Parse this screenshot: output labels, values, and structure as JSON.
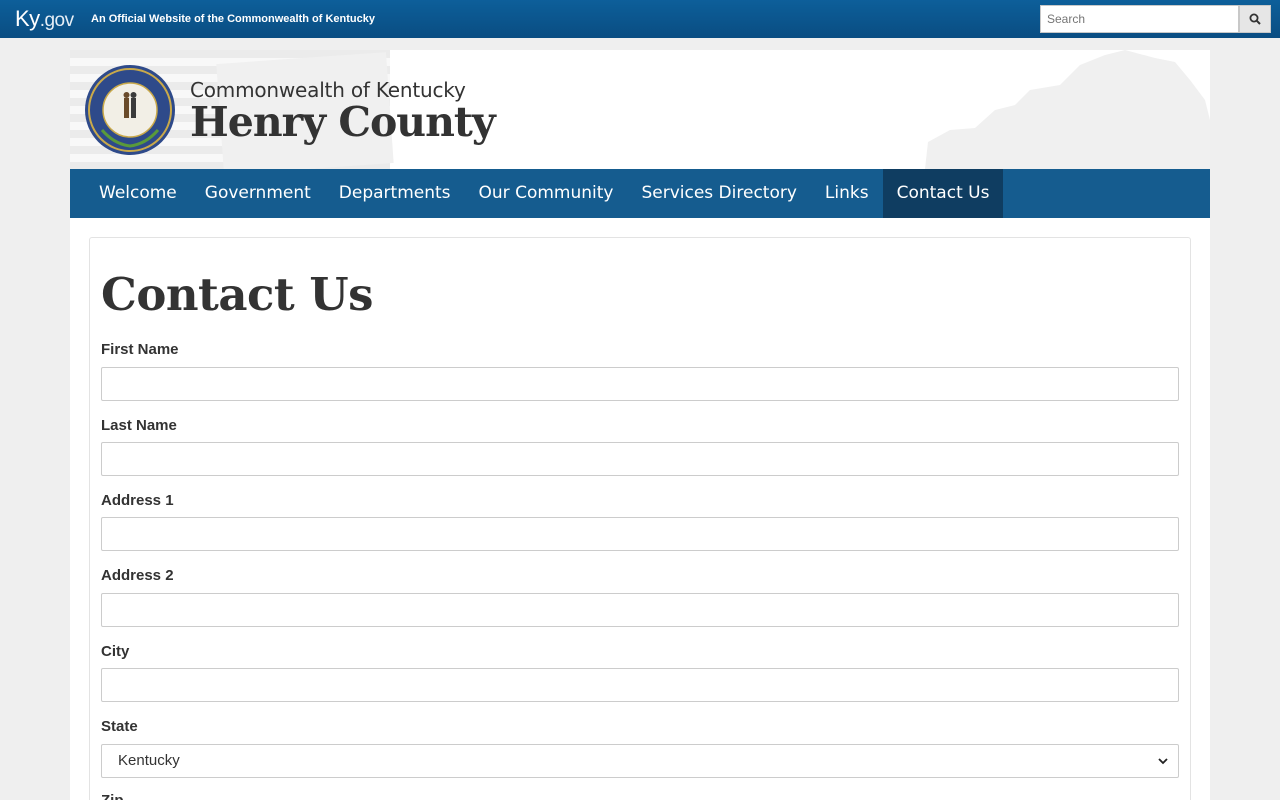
{
  "topbar": {
    "logo_main": "Ky",
    "logo_suffix": ".gov",
    "tagline": "An Official Website of the Commonwealth of Kentucky",
    "search_placeholder": "Search",
    "search_icon": "search-icon"
  },
  "header": {
    "line1": "Commonwealth of Kentucky",
    "line2": "Henry County",
    "seal_icon": "kentucky-seal"
  },
  "nav": {
    "items": [
      {
        "label": "Welcome"
      },
      {
        "label": "Government"
      },
      {
        "label": "Departments"
      },
      {
        "label": "Our Community"
      },
      {
        "label": "Services Directory"
      },
      {
        "label": "Links"
      },
      {
        "label": "Contact Us",
        "active": true
      }
    ]
  },
  "page": {
    "title": "Contact Us"
  },
  "form": {
    "first_name_label": "First Name",
    "last_name_label": "Last Name",
    "address1_label": "Address 1",
    "address2_label": "Address 2",
    "city_label": "City",
    "state_label": "State",
    "state_value": "Kentucky",
    "zip_label": "Zip"
  },
  "colors": {
    "topbar": "#0a4d82",
    "nav": "#155c8f",
    "nav_active": "#0f3d61"
  }
}
